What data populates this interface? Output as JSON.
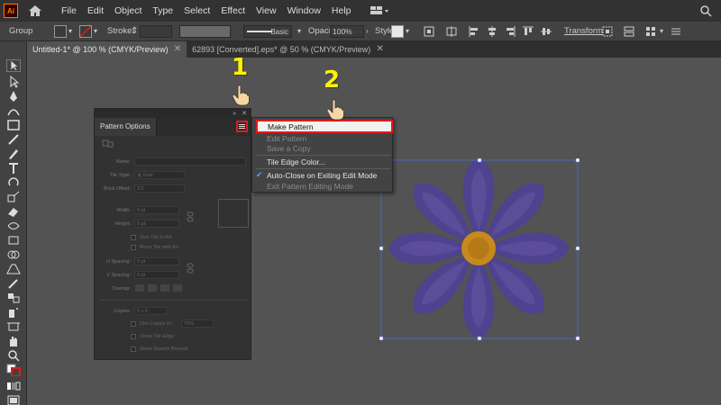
{
  "app": {
    "logo": "Ai"
  },
  "menubar": {
    "items": [
      "File",
      "Edit",
      "Object",
      "Type",
      "Select",
      "Effect",
      "View",
      "Window",
      "Help"
    ]
  },
  "controlbar": {
    "selection": "Group",
    "stroke_label": "Stroke:",
    "brush": "Basic",
    "opacity_label": "Opacity:",
    "opacity_value": "100%",
    "style_label": "Style:",
    "transform_label": "Transform"
  },
  "tabs": [
    {
      "label": "Untitled-1* @ 100 % (CMYK/Preview)",
      "active": true
    },
    {
      "label": "62893 [Converted].eps* @ 50 % (CMYK/Preview)",
      "active": false
    }
  ],
  "panel": {
    "title": "Pattern Options",
    "fields": {
      "name_label": "Name:",
      "tile_type_label": "Tile Type:",
      "tile_type_value": "Grid",
      "brick_offset_label": "Brick Offset:",
      "brick_offset_value": "1/2",
      "width_label": "Width:",
      "width_value": "0 pt",
      "height_label": "Height:",
      "height_value": "0 pt",
      "size_tile_to_art": "Size Tile to Art",
      "move_tile_with_art": "Move Tile with Art",
      "h_spacing_label": "H Spacing:",
      "h_spacing_value": "0 pt",
      "v_spacing_label": "V Spacing:",
      "v_spacing_value": "0 pt",
      "overlap_label": "Overlap:",
      "copies_label": "Copies:",
      "copies_value": "5 x 5",
      "dim_copies_label": "Dim Copies to:",
      "dim_copies_value": "70%",
      "show_tile_edge": "Show Tile Edge",
      "show_swatch_bounds": "Show Swatch Bounds"
    }
  },
  "flyout": {
    "items": [
      {
        "label": "Make Pattern",
        "enabled": true,
        "highlighted": true
      },
      {
        "label": "Edit Pattern",
        "enabled": false
      },
      {
        "label": "Save a Copy",
        "enabled": false
      },
      {
        "label": "Tile Edge Color...",
        "enabled": true
      },
      {
        "label": "Auto-Close on Exiting Edit Mode",
        "enabled": true,
        "checked": true
      },
      {
        "label": "Exit Pattern Editing Mode",
        "enabled": false
      }
    ]
  },
  "annotations": {
    "step1": "1",
    "step2": "2"
  },
  "colors": {
    "accent_red": "#e21b1b",
    "annotation_yellow": "#fff200",
    "petal": "#4f428f",
    "petal_inner": "#5b4d9a",
    "flower_center": "#c68a1c",
    "selection_blue": "#4a6fd6"
  }
}
